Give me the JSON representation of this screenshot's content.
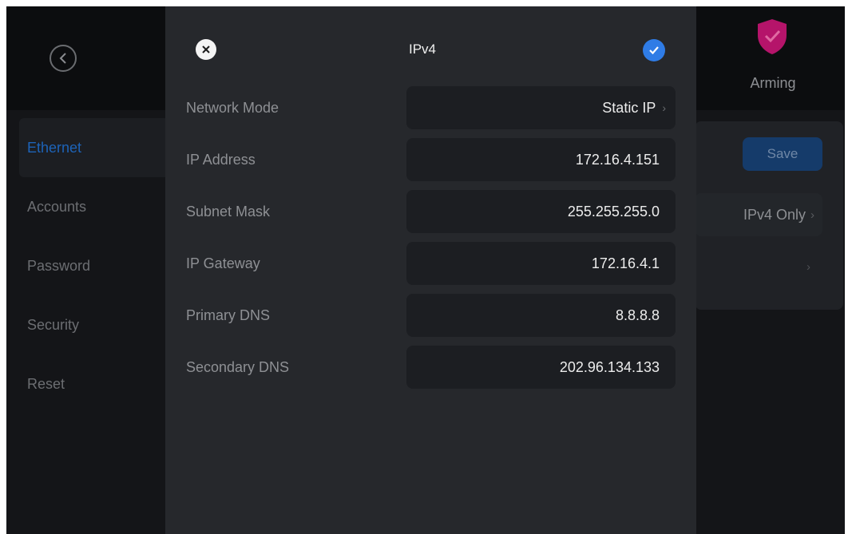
{
  "background": {
    "sidebar": {
      "items": [
        {
          "label": "Ethernet",
          "active": true
        },
        {
          "label": "Accounts",
          "active": false
        },
        {
          "label": "Password",
          "active": false
        },
        {
          "label": "Security",
          "active": false
        },
        {
          "label": "Reset",
          "active": false
        }
      ]
    },
    "header": {
      "arming_label": "Arming",
      "arming_icon": "shield-check-icon",
      "back_icon": "chevron-left-icon"
    },
    "panel": {
      "save_label": "Save",
      "ip_mode_value": "IPv4 Only",
      "chevron": "›"
    }
  },
  "modal": {
    "title": "IPv4",
    "close_icon": "close-icon",
    "confirm_icon": "check-icon",
    "rows": [
      {
        "label": "Network Mode",
        "value": "Static IP",
        "has_chevron": true
      },
      {
        "label": "IP Address",
        "value": "172.16.4.151",
        "has_chevron": false
      },
      {
        "label": "Subnet Mask",
        "value": "255.255.255.0",
        "has_chevron": false
      },
      {
        "label": "IP Gateway",
        "value": "172.16.4.1",
        "has_chevron": false
      },
      {
        "label": "Primary DNS",
        "value": "8.8.8.8",
        "has_chevron": false
      },
      {
        "label": "Secondary DNS",
        "value": "202.96.134.133",
        "has_chevron": false
      }
    ]
  },
  "colors": {
    "accent": "#2f7ce6",
    "arming_icon": "#c0176b"
  }
}
